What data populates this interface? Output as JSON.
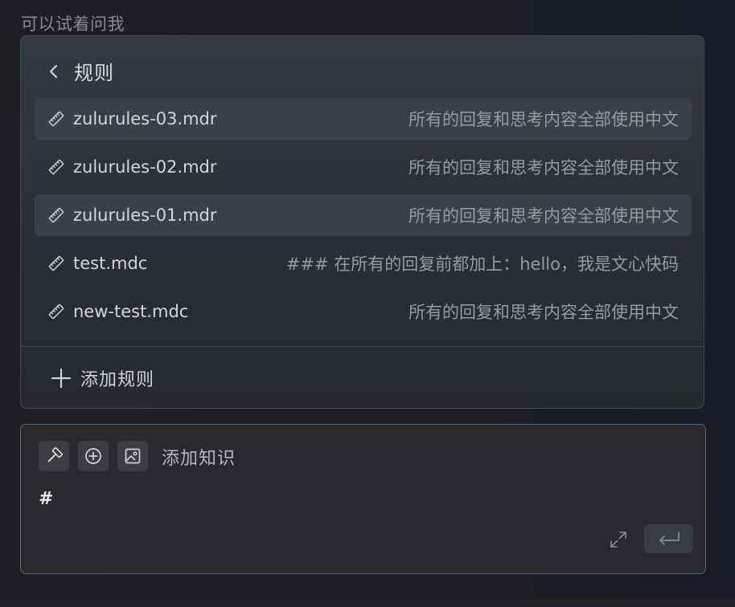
{
  "hint": {
    "text": "可以试着问我"
  },
  "panel": {
    "back_icon": "chevron-left-icon",
    "title": "规则",
    "rules": [
      {
        "name": "zulurules-03.mdr",
        "desc": "所有的回复和思考内容全部使用中文",
        "icon": "ruler-icon",
        "highlighted": true
      },
      {
        "name": "zulurules-02.mdr",
        "desc": "所有的回复和思考内容全部使用中文",
        "icon": "ruler-icon",
        "highlighted": false
      },
      {
        "name": "zulurules-01.mdr",
        "desc": "所有的回复和思考内容全部使用中文",
        "icon": "ruler-icon",
        "highlighted": true
      },
      {
        "name": "test.mdc",
        "desc": "### 在所有的回复前都加上：hello，我是文心快码",
        "icon": "ruler-icon",
        "highlighted": false
      },
      {
        "name": "new-test.mdc",
        "desc": "所有的回复和思考内容全部使用中文",
        "icon": "ruler-icon",
        "highlighted": false
      }
    ],
    "add_rule_label": "添加规则",
    "add_rule_icon": "plus-icon"
  },
  "composer": {
    "tools": [
      {
        "icon": "hammer-icon"
      },
      {
        "icon": "plus-circle-icon"
      },
      {
        "icon": "image-icon"
      }
    ],
    "add_knowledge_label": "添加知识",
    "input_value": "#",
    "expand_icon": "expand-icon",
    "send_icon": "enter-icon"
  },
  "colors": {
    "focus_border": "#3f6f86",
    "highlight_row": "#3c4046"
  }
}
